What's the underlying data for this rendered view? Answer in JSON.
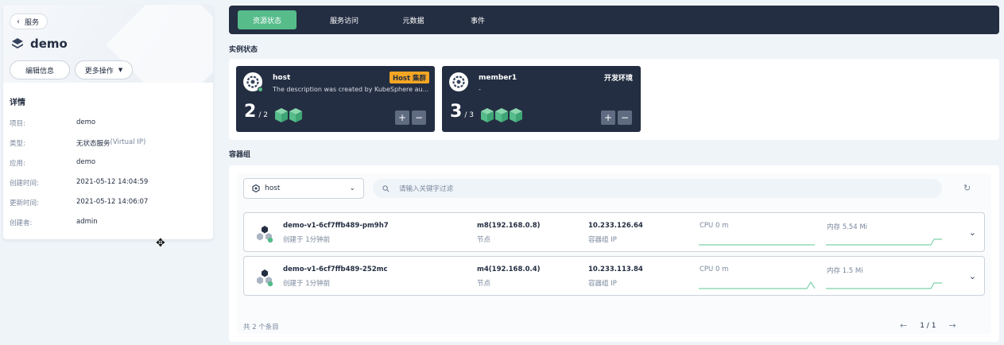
{
  "sidebar": {
    "back_label": "服务",
    "service_name": "demo",
    "edit_label": "编辑信息",
    "more_label": "更多操作",
    "details_title": "详情",
    "details": [
      {
        "key": "项目:",
        "value": "demo",
        "sub": ""
      },
      {
        "key": "类型:",
        "value": "无状态服务",
        "sub": " (Virtual IP)"
      },
      {
        "key": "应用:",
        "value": "demo",
        "sub": ""
      },
      {
        "key": "创建时间:",
        "value": "2021-05-12 14:04:59",
        "sub": ""
      },
      {
        "key": "更新时间:",
        "value": "2021-05-12 14:06:07",
        "sub": ""
      },
      {
        "key": "创建者:",
        "value": "admin",
        "sub": ""
      }
    ]
  },
  "tabs": [
    {
      "label": "资源状态",
      "active": true
    },
    {
      "label": "服务访问",
      "active": false
    },
    {
      "label": "元数据",
      "active": false
    },
    {
      "label": "事件",
      "active": false
    }
  ],
  "instance_section": {
    "title": "实例状态",
    "clusters": [
      {
        "name": "host",
        "description": "The description was created by KubeSphere au...",
        "badge": "Host 集群",
        "env": "",
        "ready": "2",
        "total": "/ 2",
        "replicas": 2
      },
      {
        "name": "member1",
        "description": "-",
        "badge": "",
        "env": "开发环境",
        "ready": "3",
        "total": "/ 3",
        "replicas": 3
      }
    ]
  },
  "pods_section": {
    "title": "容器组",
    "cluster_select": "host",
    "search_placeholder": "请输入关键字过滤",
    "rows": [
      {
        "name": "demo-v1-6cf7ffb489-pm9h7",
        "created": "创建于 1分钟前",
        "node": "m8(192.168.0.8)",
        "node_label": "节点",
        "ip": "10.233.126.64",
        "ip_label": "容器组 IP",
        "cpu": "CPU 0 m",
        "memory": "内存 5.54 Mi"
      },
      {
        "name": "demo-v1-6cf7ffb489-252mc",
        "created": "创建于 1分钟前",
        "node": "m4(192.168.0.4)",
        "node_label": "节点",
        "ip": "10.233.113.84",
        "ip_label": "容器组 IP",
        "cpu": "CPU 0 m",
        "memory": "内存 1.5 Mi"
      }
    ],
    "total_label": "共 2 个条目",
    "page_label": "1 / 1"
  },
  "colors": {
    "accent": "#55bc8a",
    "dark": "#242e42",
    "badge": "#f5a623"
  }
}
